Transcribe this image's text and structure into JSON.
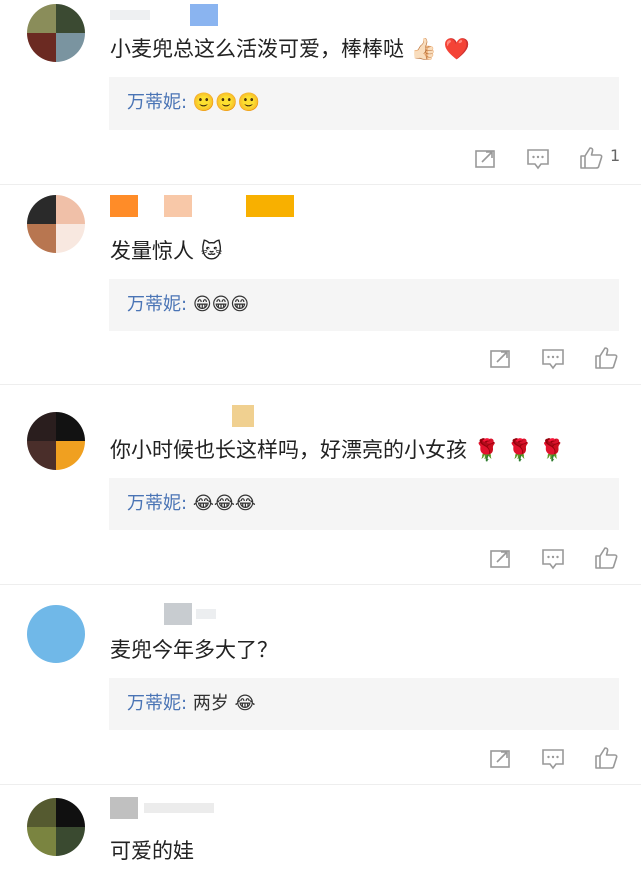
{
  "comments": [
    {
      "text": "小麦兜总这么活泼可爱，棒棒哒 👍🏻 ❤️",
      "avatar_colors": [
        "#8a8d5a",
        "#3b4a32",
        "#6b2a22",
        "#7a94a0"
      ],
      "name_colors": [
        "#8ab4f0"
      ],
      "reply": {
        "name": "万蒂妮:",
        "content": "🙂🙂🙂"
      },
      "like_count": "1"
    },
    {
      "text": "发量惊人 🐱",
      "avatar_colors": [
        "#2a2a2a",
        "#f0c0a8",
        "#b87650",
        "#f8e8e0"
      ],
      "name_colors": [
        "#ff8c28",
        "#f8c8a8",
        "#f8b000"
      ],
      "reply": {
        "name": "万蒂妮:",
        "content": "😁😁😁"
      },
      "like_count": ""
    },
    {
      "text": "你小时候也长这样吗，好漂亮的小女孩 🌹 🌹 🌹",
      "avatar_colors": [
        "#2a1e1e",
        "#121212",
        "#4a2e2a",
        "#f0a020"
      ],
      "name_colors": [
        "#f0d090"
      ],
      "reply": {
        "name": "万蒂妮:",
        "content": "😂😂😂"
      },
      "like_count": ""
    },
    {
      "text": "麦兜今年多大了？",
      "avatar_colors": [
        "#70b8e8",
        "#70b8e8",
        "#70b8e8",
        "#70b8e8"
      ],
      "name_colors": [
        "#c8ccd0"
      ],
      "reply": {
        "name": "万蒂妮:",
        "content": "两岁 😂"
      },
      "like_count": ""
    },
    {
      "text": "可爱的娃",
      "avatar_colors": [
        "#555a30",
        "#101010",
        "#7a8440",
        "#3a4a30"
      ],
      "name_colors": [
        "#c0c0c0"
      ],
      "reply": null,
      "like_count": ""
    }
  ],
  "icons": {
    "share": "share-icon",
    "comment": "comment-icon",
    "like": "like-icon"
  },
  "colors": {
    "reply_name": "#4a74b5",
    "reply_bg": "#f5f5f5",
    "icon": "#999999"
  }
}
